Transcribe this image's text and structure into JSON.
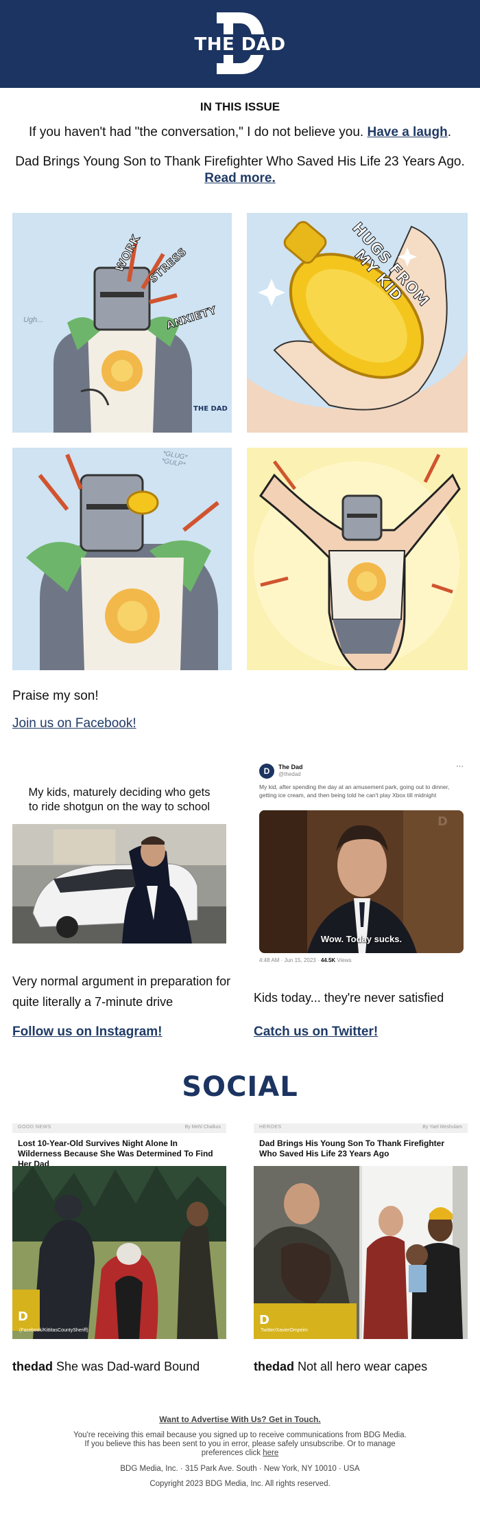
{
  "header": {
    "brand": "THE DAD",
    "logo_letter": "D",
    "bg_color": "#1c3461"
  },
  "issue": {
    "title": "IN THIS ISSUE",
    "item1_text": "If you haven't had \"the conversation,\" I do not believe you. ",
    "item1_link": "Have a laugh",
    "item1_end": ".",
    "item2_text": "Dad Brings Young Son to Thank Firefighter Who Saved His Life 23 Years Ago.",
    "item2_link": "Read more."
  },
  "meme": {
    "panel1_labels": [
      "WORK",
      "STRESS",
      "ANXIETY"
    ],
    "panel1_small": "Ugh...",
    "panel1_logo": "THE DAD",
    "panel2_label": "HUGS FROM MY KID",
    "panel3_small": "*GLUG* *GULP*"
  },
  "post1": {
    "praise": "Praise my son!",
    "facebook_link": "Join us on Facebook!"
  },
  "instagram_post": {
    "caption": "My kids, maturely deciding who gets to ride shotgun on the way to school",
    "description": "Very normal argument in preparation for quite literally a 7-minute drive",
    "link": "Follow us on Instagram!"
  },
  "twitter_post": {
    "name": "The Dad",
    "handle": "@thedad",
    "more": "···",
    "text": "My kid, after spending the day at an amusement park, going out to dinner, getting ice cream, and then being told he can't play Xbox till midnight",
    "media_caption": "Wow. Today sucks.",
    "meta_time": "4:48 AM · Jun 15, 2023 · ",
    "meta_views": "44.5K",
    "meta_views_label": " Views",
    "description": "Kids today... they're never satisfied",
    "link": "Catch us on Twitter!"
  },
  "social": {
    "title": "SOCIAL",
    "left": {
      "category": "GOOD NEWS",
      "byline": "By Mehl Chalkus",
      "headline": "Lost 10-Year-Old Survives Night Alone In Wilderness Because She Was Determined To Find Her Dad",
      "credit": "(Facebook/KittitasCountySheriff)",
      "account": "thedad",
      "text": " She was Dad-ward Bound"
    },
    "right": {
      "category": "HEROES",
      "byline": "By Yael Meshulam",
      "headline": "Dad Brings His Young Son To Thank Firefighter Who Saved His Life 23 Years Ago",
      "credit": "Twitter/XavierOmpeim",
      "account": "thedad",
      "text": " Not all hero wear capes"
    }
  },
  "footer": {
    "advertise": "Want to Advertise With Us? Get in Touch.",
    "notice1": "You're receiving this email because you signed up to receive communications from BDG Media.",
    "notice2": "If you believe this has been sent to you in error, please safely unsubscribe. Or to manage",
    "notice3": "preferences click ",
    "here": "here",
    "address": "BDG Media, Inc. · 315 Park Ave. South · New York, NY 10010 · USA",
    "copyright": "Copyright 2023 BDG Media, Inc. All rights reserved."
  },
  "colors": {
    "brand_navy": "#1c3461",
    "link": "#1f3a66"
  }
}
